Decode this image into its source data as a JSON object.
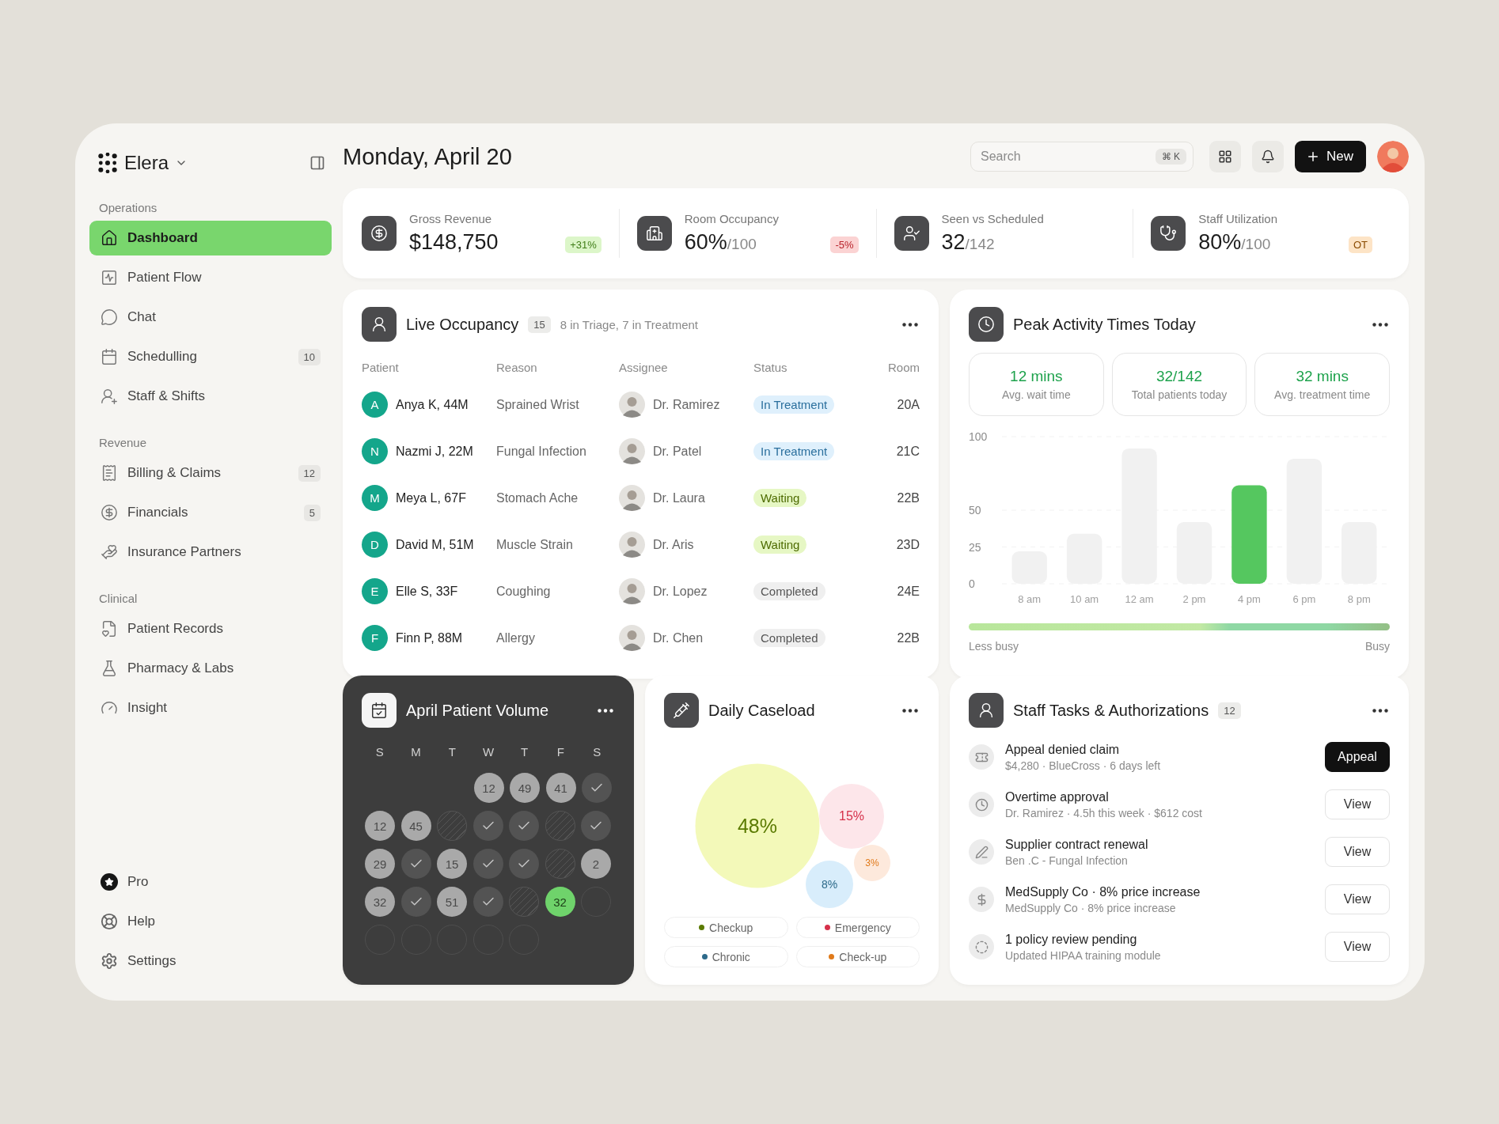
{
  "sidebar": {
    "brand": "Elera",
    "sections": [
      {
        "title": "Operations",
        "items": [
          {
            "label": "Dashboard",
            "selected": true
          },
          {
            "label": "Patient Flow",
            "selected": false
          },
          {
            "label": "Chat",
            "selected": false
          },
          {
            "label": "Schedulling",
            "badge": "10",
            "selected": false
          },
          {
            "label": "Staff & Shifts",
            "selected": false
          }
        ]
      },
      {
        "title": "Revenue",
        "items": [
          {
            "label": "Billing & Claims",
            "badge": "12",
            "selected": false
          },
          {
            "label": "Financials",
            "badge": "5",
            "selected": false
          },
          {
            "label": "Insurance Partners",
            "selected": false
          }
        ]
      },
      {
        "title": "Clinical",
        "items": [
          {
            "label": "Patient Records",
            "selected": false
          },
          {
            "label": "Pharmacy & Labs",
            "selected": false
          },
          {
            "label": "Insight",
            "selected": false
          }
        ]
      }
    ],
    "footer": [
      "Pro",
      "Help",
      "Settings"
    ]
  },
  "header": {
    "title": "Monday, April 20",
    "search": {
      "placeholder": "Search",
      "shortcut": "⌘ K"
    },
    "new_button": "New"
  },
  "kpis": [
    {
      "label": "Gross Revenue",
      "value": "$148,750",
      "delta": "+31%",
      "kind": "positive"
    },
    {
      "label": "Room Occupancy",
      "value": "60%",
      "unit": "/100",
      "delta": "-5%",
      "kind": "negative"
    },
    {
      "label": "Seen vs Scheduled",
      "value": "32",
      "unit": "/142"
    },
    {
      "label": "Staff Utilization",
      "value": "80%",
      "unit": "/100",
      "delta": "OT",
      "kind": "warning"
    }
  ],
  "live_occupancy": {
    "title": "Live Occupancy",
    "count": "15",
    "summary": "8 in Triage, 7 in Treatment",
    "columns": [
      "Patient",
      "Reason",
      "Assignee",
      "Status",
      "Room"
    ],
    "rows": [
      {
        "initial": "A",
        "patient": "Anya K, 44M",
        "reason": "Sprained Wrist",
        "assignee": "Dr. Ramirez",
        "status": "In Treatment",
        "kind": "treatment",
        "room": "20A"
      },
      {
        "initial": "N",
        "patient": "Nazmi J, 22M",
        "reason": "Fungal Infection",
        "assignee": "Dr. Patel",
        "status": "In Treatment",
        "kind": "treatment",
        "room": "21C"
      },
      {
        "initial": "M",
        "patient": "Meya L, 67F",
        "reason": "Stomach Ache",
        "assignee": "Dr. Laura",
        "status": "Waiting",
        "kind": "waiting",
        "room": "22B"
      },
      {
        "initial": "D",
        "patient": "David M, 51M",
        "reason": "Muscle Strain",
        "assignee": "Dr. Aris",
        "status": "Waiting",
        "kind": "waiting",
        "room": "23D"
      },
      {
        "initial": "E",
        "patient": "Elle S, 33F",
        "reason": "Coughing",
        "assignee": "Dr. Lopez",
        "status": "Completed",
        "kind": "completed",
        "room": "24E"
      },
      {
        "initial": "F",
        "patient": "Finn P, 88M",
        "reason": "Allergy",
        "assignee": "Dr. Chen",
        "status": "Completed",
        "kind": "completed",
        "room": "22B"
      }
    ]
  },
  "peak_activity": {
    "title": "Peak Activity Times Today",
    "stats": [
      {
        "value": "12 mins",
        "label": "Avg. wait time"
      },
      {
        "value": "32/142",
        "label": "Total patients today"
      },
      {
        "value": "32 mins",
        "label": "Avg. treatment time"
      }
    ],
    "chart_data": {
      "type": "bar",
      "categories": [
        "8 am",
        "10 am",
        "12 am",
        "2 pm",
        "4 pm",
        "6 pm",
        "8 pm"
      ],
      "series": [
        {
          "color": "#f1f1f1",
          "values": [
            22,
            34,
            92,
            42,
            null,
            85,
            42
          ]
        },
        {
          "color": "#55c75f",
          "values": [
            null,
            null,
            null,
            null,
            67,
            null,
            null
          ]
        }
      ],
      "yticks": [
        0,
        25,
        50,
        100
      ],
      "ylim": [
        0,
        100
      ]
    },
    "scale": {
      "low": "Less busy",
      "high": "Busy"
    }
  },
  "patient_volume": {
    "title": "April Patient Volume",
    "weekdays": [
      "S",
      "M",
      "T",
      "W",
      "T",
      "F",
      "S"
    ],
    "weeks": [
      [
        {
          "kind": "count",
          "text": "12"
        },
        {
          "kind": "count",
          "text": "49"
        },
        {
          "kind": "count",
          "text": "41"
        },
        {
          "kind": "check"
        }
      ],
      [
        {
          "kind": "count",
          "text": "12"
        },
        {
          "kind": "count",
          "text": "45"
        },
        {
          "kind": "hatched"
        },
        {
          "kind": "check"
        },
        {
          "kind": "check"
        },
        {
          "kind": "hatched"
        },
        {
          "kind": "check"
        }
      ],
      [
        {
          "kind": "count",
          "text": "29"
        },
        {
          "kind": "check"
        },
        {
          "kind": "count",
          "text": "15"
        },
        {
          "kind": "check"
        },
        {
          "kind": "check"
        },
        {
          "kind": "hatched"
        },
        {
          "kind": "count",
          "text": "2"
        }
      ],
      [
        {
          "kind": "count",
          "text": "32"
        },
        {
          "kind": "check"
        },
        {
          "kind": "count",
          "text": "51"
        },
        {
          "kind": "check"
        },
        {
          "kind": "hatched"
        },
        {
          "kind": "today",
          "text": "32"
        },
        {
          "kind": "empty"
        }
      ],
      [
        {
          "kind": "empty"
        },
        {
          "kind": "empty"
        },
        {
          "kind": "empty"
        },
        {
          "kind": "empty"
        },
        {
          "kind": "empty"
        }
      ]
    ]
  },
  "daily_caseload": {
    "title": "Daily Caseload",
    "bubbles": [
      {
        "label": "48%",
        "color": "#f3f9b9"
      },
      {
        "label": "15%",
        "color": "#fde6ea"
      },
      {
        "label": "8%",
        "color": "#d8edfb"
      },
      {
        "label": "3%",
        "color": "#fde9dc"
      }
    ],
    "legend": [
      {
        "label": "Checkup",
        "color": "#5a7a00"
      },
      {
        "label": "Emergency",
        "color": "#d6304a"
      },
      {
        "label": "Chronic",
        "color": "#2d6a8a"
      },
      {
        "label": "Check-up",
        "color": "#e07a1a"
      }
    ]
  },
  "staff_tasks": {
    "title": "Staff Tasks & Authorizations",
    "count": "12",
    "items": [
      {
        "title": "Appeal denied claim",
        "detail": "$4,280 · BlueCross · 6 days left",
        "action": "Appeal",
        "primary": true
      },
      {
        "title": "Overtime approval",
        "detail": "Dr. Ramirez · 4.5h this week · $612 cost",
        "action": "View",
        "primary": false
      },
      {
        "title": "Supplier contract renewal",
        "detail": "Ben .C - Fungal Infection",
        "action": "View",
        "primary": false
      },
      {
        "title": "MedSupply Co · 8% price increase",
        "detail": "MedSupply Co · 8% price increase",
        "action": "View",
        "primary": false
      },
      {
        "title": "1 policy review pending",
        "detail": "Updated HIPAA training module",
        "action": "View",
        "primary": false
      }
    ]
  }
}
